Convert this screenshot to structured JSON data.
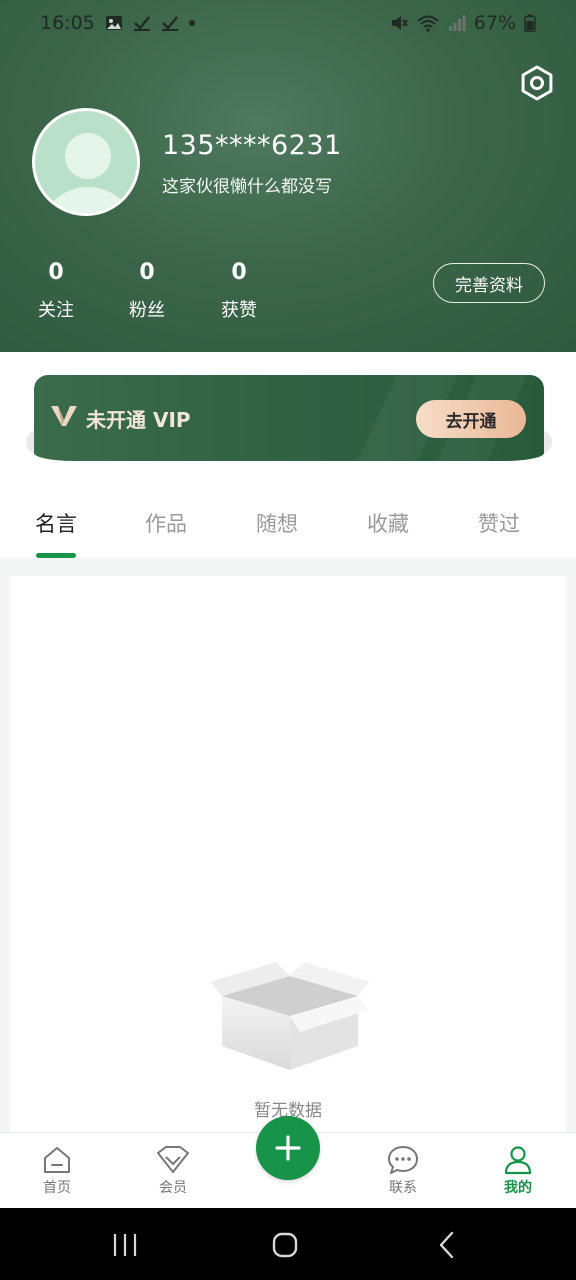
{
  "status_bar": {
    "time": "16:05",
    "battery": "67%"
  },
  "profile": {
    "phone": "135****6231",
    "bio": "这家伙很懒什么都没写",
    "edit_label": "完善资料",
    "stats": [
      {
        "value": "0",
        "label": "关注"
      },
      {
        "value": "0",
        "label": "粉丝"
      },
      {
        "value": "0",
        "label": "获赞"
      }
    ]
  },
  "vip": {
    "status": "未开通 VIP",
    "button": "去开通"
  },
  "tabs": [
    {
      "label": "名言",
      "active": true
    },
    {
      "label": "作品",
      "active": false
    },
    {
      "label": "随想",
      "active": false
    },
    {
      "label": "收藏",
      "active": false
    },
    {
      "label": "赞过",
      "active": false
    }
  ],
  "empty_state": {
    "text": "暂无数据"
  },
  "bottom_nav": [
    {
      "label": "首页",
      "icon": "home-icon"
    },
    {
      "label": "会员",
      "icon": "vip-icon"
    },
    {
      "label": "联系",
      "icon": "chat-icon"
    },
    {
      "label": "我的",
      "icon": "user-icon",
      "active": true
    }
  ],
  "colors": {
    "brand_green": "#17944a",
    "header_green": "#3c6549",
    "vip_gold": "#eab896"
  }
}
